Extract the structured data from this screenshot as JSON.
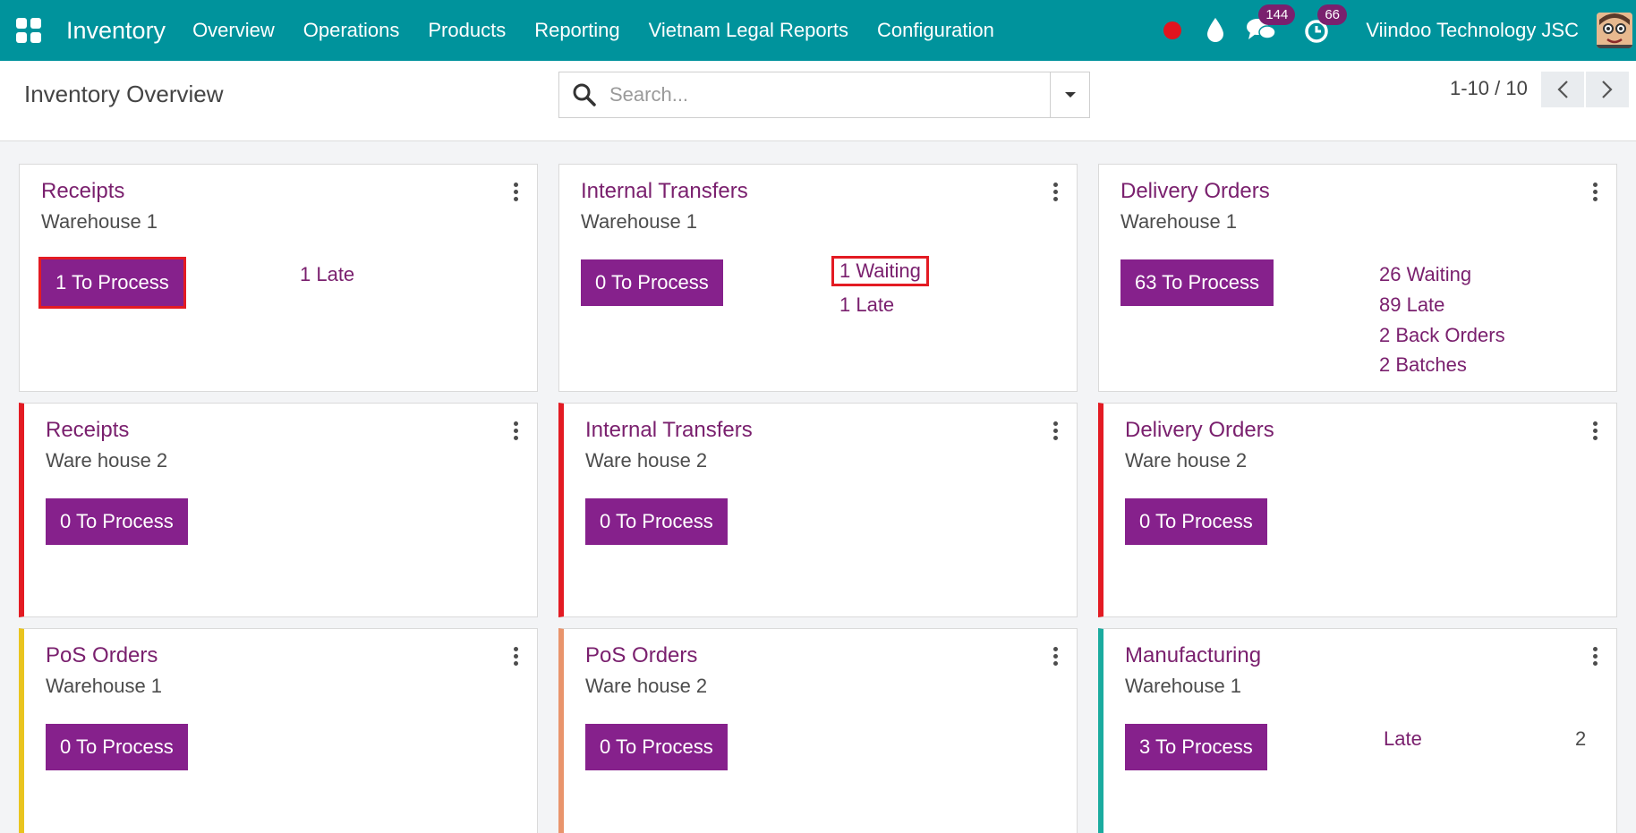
{
  "navbar": {
    "brand": "Inventory",
    "menu": [
      "Overview",
      "Operations",
      "Products",
      "Reporting",
      "Vietnam Legal Reports",
      "Configuration"
    ],
    "chat_badge": "144",
    "activity_badge": "66",
    "company": "Viindoo Technology JSC"
  },
  "control": {
    "title": "Inventory Overview",
    "search_placeholder": "Search...",
    "pager": "1-10 / 10"
  },
  "cards": [
    {
      "title": "Receipts",
      "warehouse": "Warehouse 1",
      "button": "1 To Process",
      "links": [
        "1 Late"
      ]
    },
    {
      "title": "Internal Transfers",
      "warehouse": "Warehouse 1",
      "button": "0 To Process",
      "links": [
        "1 Waiting",
        "1 Late"
      ]
    },
    {
      "title": "Delivery Orders",
      "warehouse": "Warehouse 1",
      "button": "63 To Process",
      "links": [
        "26 Waiting",
        "89 Late",
        "2 Back Orders",
        "2 Batches"
      ]
    },
    {
      "title": "Receipts",
      "warehouse": "Ware house 2",
      "button": "0 To Process"
    },
    {
      "title": "Internal Transfers",
      "warehouse": "Ware house 2",
      "button": "0 To Process"
    },
    {
      "title": "Delivery Orders",
      "warehouse": "Ware house 2",
      "button": "0 To Process"
    },
    {
      "title": "PoS Orders",
      "warehouse": "Warehouse 1",
      "button": "0 To Process"
    },
    {
      "title": "PoS Orders",
      "warehouse": "Ware house 2",
      "button": "0 To Process"
    },
    {
      "title": "Manufacturing",
      "warehouse": "Warehouse 1",
      "button": "3 To Process",
      "late_label": "Late",
      "late_count": "2"
    }
  ],
  "colors": {
    "navbar": "#00939c",
    "brand_purple": "#86218c",
    "link_purple": "#7a206e",
    "accent_red": "#e31b23",
    "accent_yellow": "#e9c41f",
    "accent_orange": "#e9946c",
    "accent_teal": "#1bab9f"
  }
}
